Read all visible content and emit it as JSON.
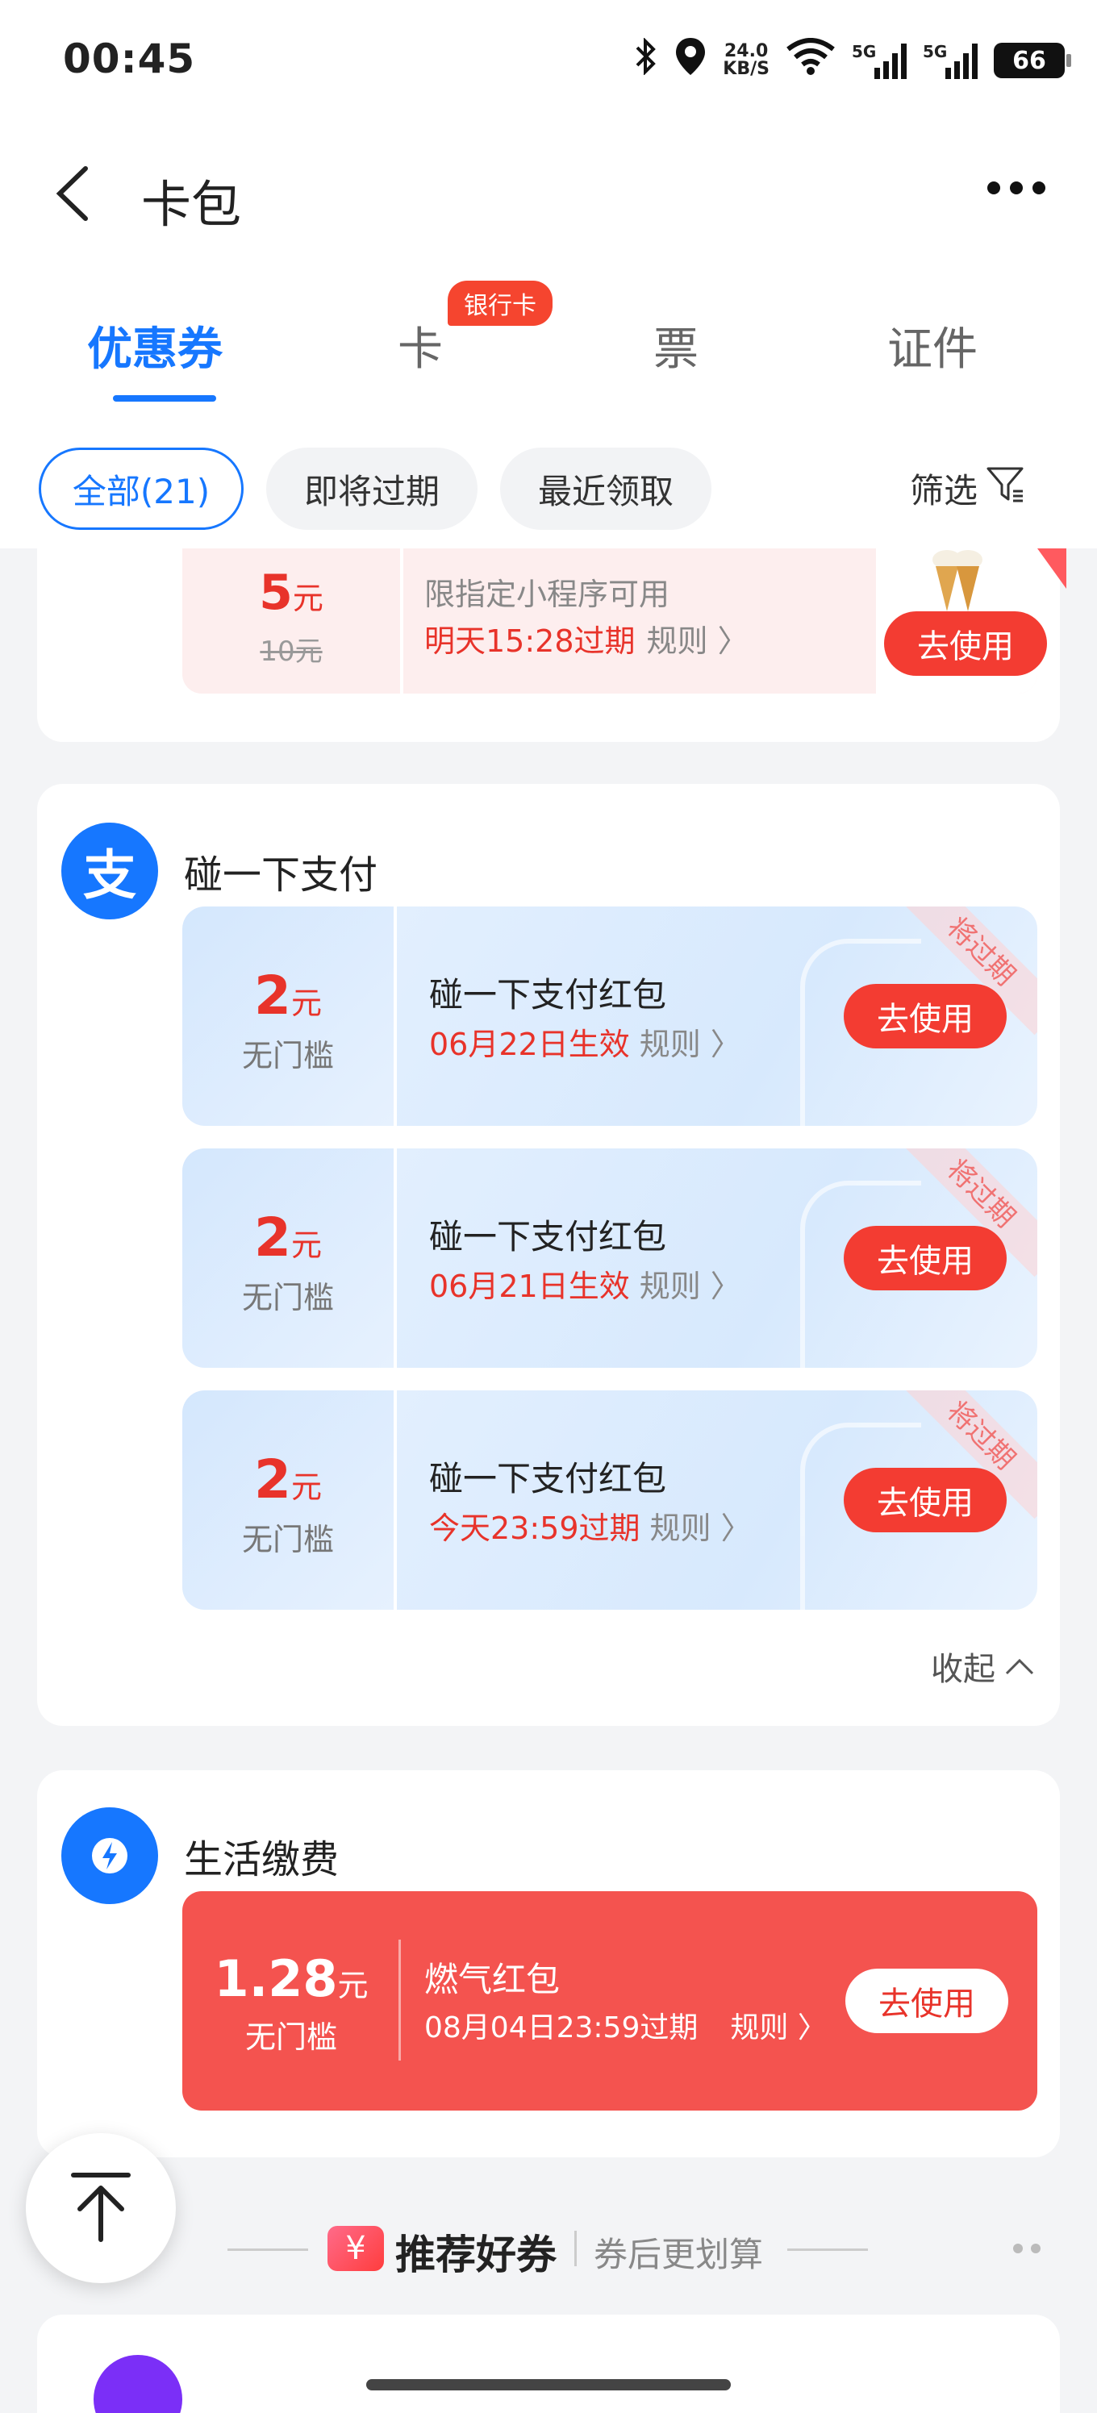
{
  "status": {
    "time": "00:45",
    "net_speed_value": "24.0",
    "net_speed_unit": "KB/S",
    "sig1": "5G",
    "sig2": "5G",
    "battery": "66"
  },
  "nav": {
    "title": "卡包"
  },
  "tabs": [
    {
      "label": "优惠券"
    },
    {
      "label": "卡"
    },
    {
      "label": "票"
    },
    {
      "label": "证件"
    }
  ],
  "card_badge": "银行卡",
  "filters": {
    "all": "全部(21)",
    "expiring": "即将过期",
    "recent": "最近领取",
    "filter": "筛选"
  },
  "partial_coupon": {
    "amount": "5",
    "unit": "元",
    "original": "10元",
    "desc": "限指定小程序可用",
    "expiry": "明天15:28过期",
    "rule": "规则 〉",
    "button": "去使用"
  },
  "touch_pay": {
    "logo": "支",
    "title": "碰一下支付",
    "coupons": [
      {
        "amount": "2",
        "unit": "元",
        "threshold": "无门槛",
        "name": "碰一下支付红包",
        "date": "06月22日生效",
        "rule": "规则 〉",
        "button": "去使用",
        "ribbon": "将过期"
      },
      {
        "amount": "2",
        "unit": "元",
        "threshold": "无门槛",
        "name": "碰一下支付红包",
        "date": "06月21日生效",
        "rule": "规则 〉",
        "button": "去使用",
        "ribbon": "将过期"
      },
      {
        "amount": "2",
        "unit": "元",
        "threshold": "无门槛",
        "name": "碰一下支付红包",
        "date": "今天23:59过期",
        "rule": "规则 〉",
        "button": "去使用",
        "ribbon": "将过期"
      }
    ],
    "collapse": "收起"
  },
  "utility": {
    "title": "生活缴费",
    "coupon": {
      "amount": "1.28",
      "unit": "元",
      "threshold": "无门槛",
      "name": "燃气红包",
      "date": "08月04日23:59过期",
      "rule": "规则 〉",
      "button": "去使用"
    }
  },
  "recommend": {
    "title": "推荐好券",
    "subtitle": "券后更划算"
  },
  "colors": {
    "accent": "#1677ff",
    "red": "#f33c32"
  }
}
